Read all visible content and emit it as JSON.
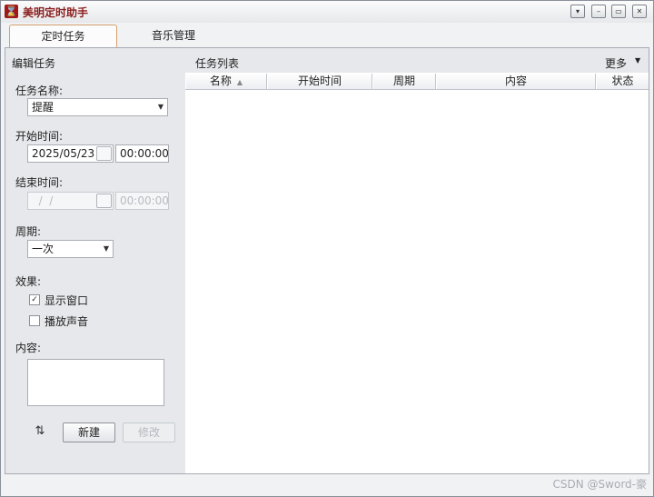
{
  "window": {
    "title": "美明定时助手",
    "app_icon_glyph": "⌛",
    "controls": {
      "dropdown": "▾",
      "minimize": "–",
      "restore": "▭",
      "close": "✕"
    }
  },
  "tabs": [
    {
      "label": "定时任务",
      "active": true
    },
    {
      "label": "音乐管理",
      "active": false
    }
  ],
  "edit_panel": {
    "title": "编辑任务",
    "task_name_label": "任务名称:",
    "task_name_value": "提醒",
    "start_time_label": "开始时间:",
    "start_date": "2025/05/23",
    "start_time": "00:00:00",
    "end_time_label": "结束时间:",
    "end_date": "  /  /",
    "end_time": "00:00:00",
    "period_label": "周期:",
    "period_value": "一次",
    "effect_label": "效果:",
    "show_window_label": "显示窗口",
    "show_window_checked": true,
    "play_sound_label": "播放声音",
    "play_sound_checked": false,
    "content_label": "内容:",
    "content_value": "",
    "new_button": "新建",
    "modify_button": "修改",
    "refresh_glyph": "⇅"
  },
  "task_list": {
    "title": "任务列表",
    "more_label": "更多",
    "columns": [
      "名称",
      "开始时间",
      "周期",
      "内容",
      "状态"
    ],
    "rows": []
  },
  "watermark": "CSDN @Sword-豪",
  "colors": {
    "title_accent": "#8b1d1d",
    "tab_border": "#d6a06a"
  }
}
